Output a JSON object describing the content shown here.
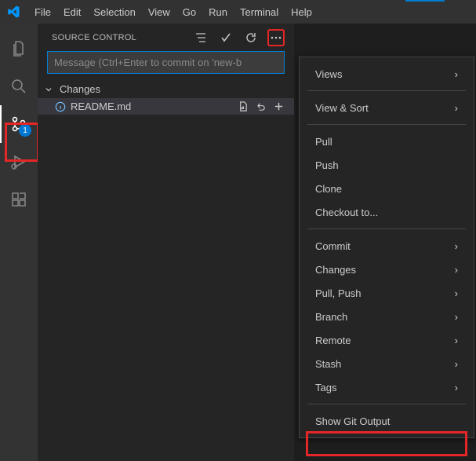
{
  "menubar": {
    "items": [
      "File",
      "Edit",
      "Selection",
      "View",
      "Go",
      "Run",
      "Terminal",
      "Help"
    ]
  },
  "activitybar": {
    "scm_badge": "1"
  },
  "sidebar": {
    "title": "SOURCE CONTROL",
    "commit_placeholder": "Message (Ctrl+Enter to commit on 'new-b",
    "changes_label": "Changes",
    "file": {
      "name": "README.md"
    }
  },
  "context_menu": {
    "group1": [
      "Views",
      "View & Sort"
    ],
    "group2": [
      "Pull",
      "Push",
      "Clone",
      "Checkout to..."
    ],
    "group3": [
      "Commit",
      "Changes",
      "Pull, Push",
      "Branch",
      "Remote",
      "Stash",
      "Tags"
    ],
    "group4": [
      "Show Git Output"
    ]
  }
}
